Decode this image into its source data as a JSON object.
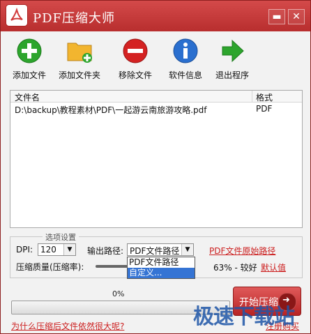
{
  "window": {
    "title": "PDF压缩大师",
    "min_glyph": "▬",
    "close_glyph": "✕",
    "accent": "#c23a3a"
  },
  "toolbar": {
    "items": [
      {
        "label": "添加文件",
        "icon": "add-file-icon",
        "color": "#2da52d"
      },
      {
        "label": "添加文件夹",
        "icon": "add-folder-icon",
        "color": "#e6a51f"
      },
      {
        "label": "移除文件",
        "icon": "remove-file-icon",
        "color": "#d42222"
      },
      {
        "label": "软件信息",
        "icon": "info-icon",
        "color": "#2a6fcf"
      },
      {
        "label": "退出程序",
        "icon": "exit-arrow-icon",
        "color": "#2da52d"
      }
    ]
  },
  "file_list": {
    "headers": {
      "name": "文件名",
      "format": "格式"
    },
    "rows": [
      {
        "name": "D:\\backup\\教程素材\\PDF\\一起游云南旅游攻略.pdf",
        "format": "PDF"
      }
    ]
  },
  "settings": {
    "legend": "选项设置",
    "dpi_label": "DPI:",
    "dpi_value": "120",
    "output_label": "输出路径:",
    "output_value": "PDF文件路径",
    "output_options": [
      "PDF文件路径",
      "自定义..."
    ],
    "output_link": "PDF文件原始路径",
    "quality_label": "压缩质量(压缩率):",
    "quality_value": "63% - 较好",
    "default_link": "默认值"
  },
  "progress": {
    "percent_text": "0%",
    "value": 0
  },
  "start_button": {
    "label": "开始压缩"
  },
  "footer": {
    "why_link": "为什么压缩后文件依然很大呢?",
    "register_link": "注册购买"
  },
  "watermark": "极速下载站"
}
